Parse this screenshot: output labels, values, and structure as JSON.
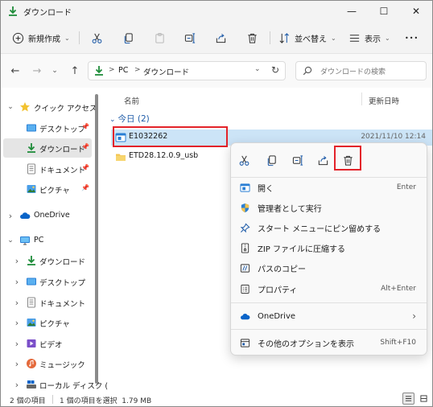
{
  "window": {
    "title": "ダウンロード",
    "minimize_glyph": "—",
    "maximize_glyph": "☐",
    "close_glyph": "✕"
  },
  "toolbar": {
    "new_label": "新規作成",
    "sort_label": "並べ替え",
    "view_label": "表示",
    "more_glyph": "•••"
  },
  "address": {
    "segments": [
      "PC",
      "ダウンロード"
    ],
    "separator": ">",
    "search_placeholder": "ダウンロードの検索"
  },
  "sidebar": {
    "items": [
      {
        "label": "クイック アクセス",
        "icon": "star-icon",
        "pinned": false,
        "chevron": "⌄"
      },
      {
        "label": "デスクトップ",
        "icon": "desktop-icon",
        "pinned": true
      },
      {
        "label": "ダウンロード",
        "icon": "download-icon",
        "pinned": true
      },
      {
        "label": "ドキュメント",
        "icon": "document-icon",
        "pinned": true
      },
      {
        "label": "ピクチャ",
        "icon": "picture-icon",
        "pinned": true
      },
      {
        "label": "OneDrive",
        "icon": "cloud-icon",
        "chevron": "›"
      },
      {
        "label": "PC",
        "icon": "pc-icon",
        "chevron": "⌄"
      },
      {
        "label": "ダウンロード",
        "icon": "download-icon",
        "chevron": "›"
      },
      {
        "label": "デスクトップ",
        "icon": "desktop-icon",
        "chevron": "›"
      },
      {
        "label": "ドキュメント",
        "icon": "document-icon",
        "chevron": "›"
      },
      {
        "label": "ピクチャ",
        "icon": "picture-icon",
        "chevron": "›"
      },
      {
        "label": "ビデオ",
        "icon": "video-icon",
        "chevron": "›"
      },
      {
        "label": "ミュージック",
        "icon": "music-icon",
        "chevron": "›"
      },
      {
        "label": "ローカル ディスク (",
        "icon": "disk-icon",
        "chevron": "›"
      }
    ]
  },
  "content": {
    "col_name": "名前",
    "col_date": "更新日時",
    "group_label": "今日 (2)",
    "files": [
      {
        "name": "E1032262",
        "date": "2021/11/10 12:14",
        "icon": "application-icon",
        "selected": true
      },
      {
        "name": "ETD28.12.0.9_usb",
        "date": "",
        "icon": "folder-icon",
        "selected": false
      }
    ]
  },
  "context_menu": {
    "toolbar_icons": [
      "cut-icon",
      "copy-icon",
      "rename-icon",
      "share-icon",
      "delete-icon"
    ],
    "items": [
      {
        "label": "開く",
        "shortcut": "Enter",
        "icon": "open-icon"
      },
      {
        "label": "管理者として実行",
        "shortcut": "",
        "icon": "shield-icon"
      },
      {
        "label": "スタート メニューにピン留めする",
        "shortcut": "",
        "icon": "pin-icon"
      },
      {
        "label": "ZIP ファイルに圧縮する",
        "shortcut": "",
        "icon": "zip-icon"
      },
      {
        "label": "パスのコピー",
        "shortcut": "",
        "icon": "path-copy-icon"
      },
      {
        "label": "プロパティ",
        "shortcut": "Alt+Enter",
        "icon": "properties-icon"
      },
      {
        "label": "OneDrive",
        "shortcut": "›",
        "icon": "cloud-icon"
      },
      {
        "label": "その他のオプションを表示",
        "shortcut": "Shift+F10",
        "icon": "more-options-icon"
      }
    ]
  },
  "status": {
    "item_count": "2 個の項目",
    "selection": "1 個の項目を選択  1.79 MB"
  },
  "colors": {
    "accent": "#0078d4",
    "selection": "#cce4f7",
    "highlight_box": "#e3232a",
    "group_header": "#1e5ba8"
  }
}
